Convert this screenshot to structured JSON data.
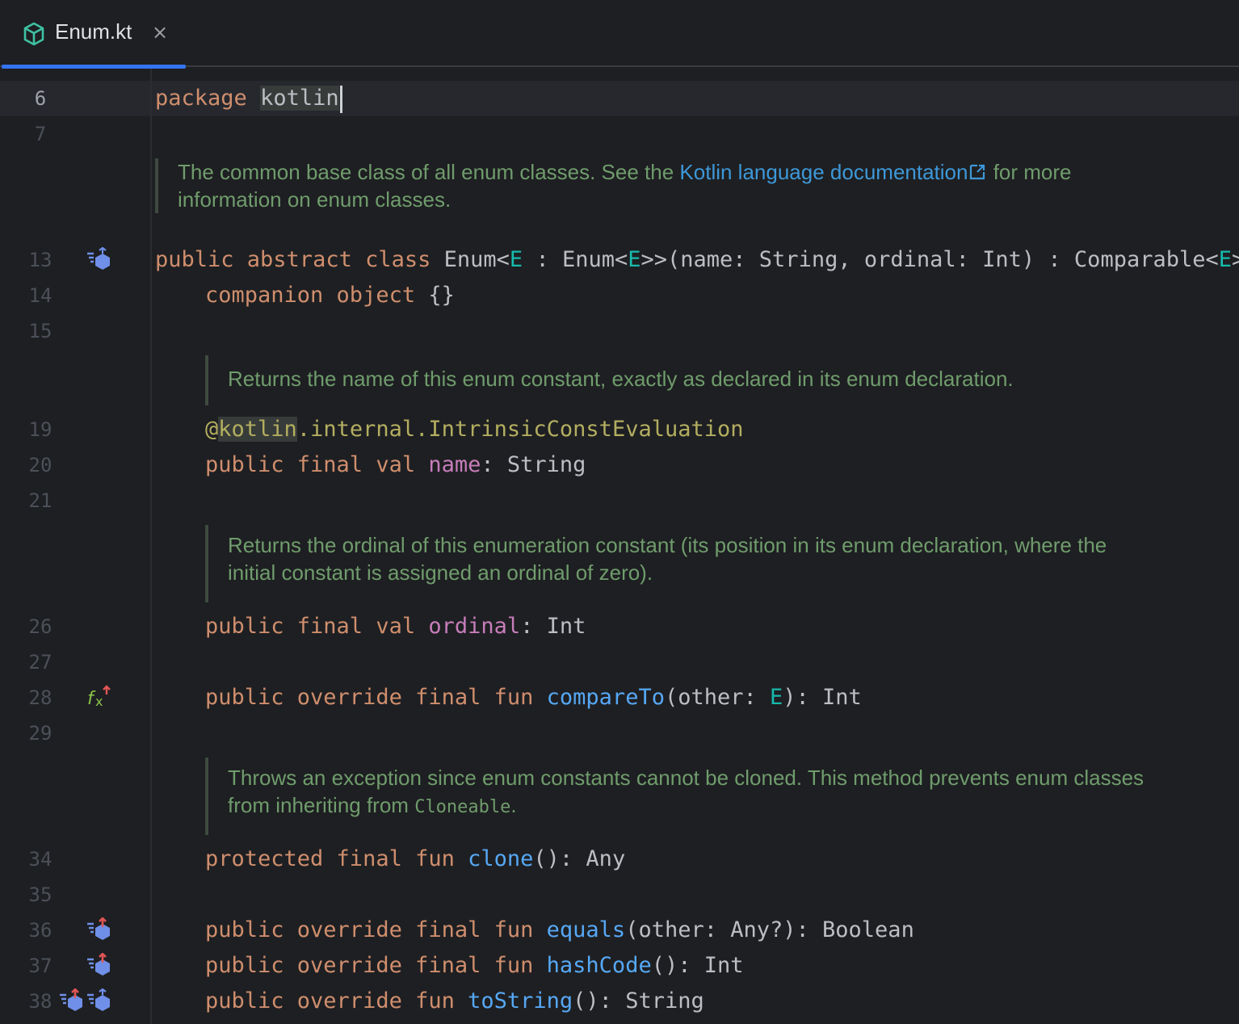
{
  "tab": {
    "label": "Enum.kt",
    "close": "×",
    "icon": "kotlin-file-icon"
  },
  "editor": {
    "line_numbers": [
      "6",
      "7",
      "13",
      "14",
      "15",
      "19",
      "20",
      "21",
      "26",
      "27",
      "28",
      "29",
      "34",
      "35",
      "36",
      "37",
      "38"
    ],
    "docs": {
      "doc1_a": "The common base class of all enum classes. See the ",
      "doc1_link": "Kotlin language documentation",
      "doc1_b": " for more",
      "doc1_c": "information on enum classes.",
      "doc2": "Returns the name of this enum constant, exactly as declared in its enum declaration.",
      "doc3_a": "Returns the ordinal of this enumeration constant (its position in its enum declaration, where the",
      "doc3_b": "initial constant is assigned an ordinal of zero).",
      "doc4_a": "Throws an exception since enum constants cannot be cloned. This method prevents enum classes",
      "doc4_b": "from inheriting from ",
      "doc4_code": "Cloneable",
      "doc4_c": "."
    },
    "code": {
      "l6_kw": "package",
      "l6_pkg": "kotlin",
      "l13_kw": "public abstract class",
      "l13_name": "Enum<",
      "l13_e1": "E",
      "l13_a": " : Enum<",
      "l13_e2": "E",
      "l13_b": ">>(name: String, ordinal: Int) : Comparable<",
      "l13_e3": "E",
      "l13_c": "> {",
      "l14_kw": "companion object",
      "l14_rest": " {}",
      "l19_at": "@",
      "l19_kotlin": "kotlin",
      "l19_rest": ".internal.IntrinsicConstEvaluation",
      "l20_kw": "public final val",
      "l20_prop": "name",
      "l20_rest": ": String",
      "l26_kw": "public final val",
      "l26_prop": "ordinal",
      "l26_rest": ": Int",
      "l28_kw": "public override final fun",
      "l28_fn": "compareTo",
      "l28_a": "(other: ",
      "l28_e": "E",
      "l28_b": "): Int",
      "l34_kw": "protected final fun",
      "l34_fn": "clone",
      "l34_rest": "(): Any",
      "l36_kw": "public override final fun",
      "l36_fn": "equals",
      "l36_rest": "(other: Any?): Boolean",
      "l37_kw": "public override final fun",
      "l37_fn": "hashCode",
      "l37_rest": "(): Int",
      "l38_kw": "public override fun",
      "l38_fn": "toString",
      "l38_rest": "(): String"
    },
    "gutter_icons": [
      "implemented-icon",
      "overrides-function-icon",
      "overrides-icon",
      "overrides-icon",
      "overrides-icon",
      "implemented-icon"
    ]
  }
}
